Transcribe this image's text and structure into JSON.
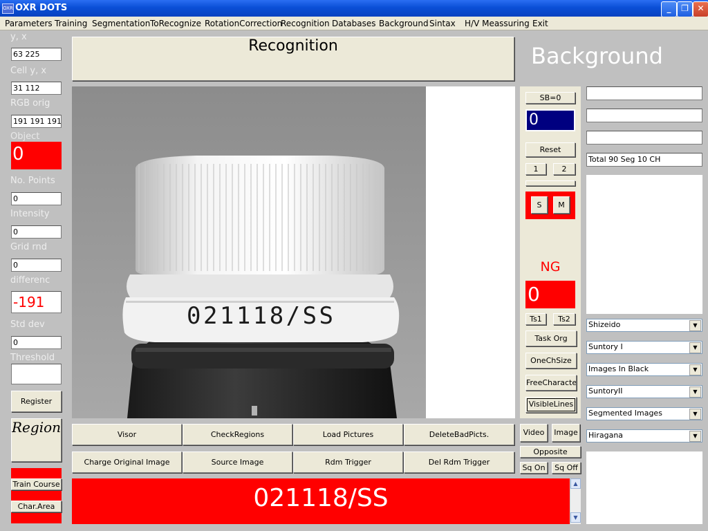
{
  "window": {
    "title": "OXR DOTS",
    "app_icon_text": "OXR",
    "min": "_",
    "restore": "❐",
    "close": "✕"
  },
  "menu": [
    "Parameters",
    "Training",
    "Segmentation",
    "ToRecognize",
    "RotationCorrection",
    "Recognition",
    "Databases",
    "Background",
    "Sintax",
    "H/V Meassuring",
    "Exit"
  ],
  "left": {
    "yx_label": "y, x",
    "yx_value": "63 225",
    "cell_label": "Cell y, x",
    "cell_value": "31 112",
    "rgb_label": "RGB orig",
    "rgb_value": "191 191 191",
    "object_label": "Object",
    "object_value": "0",
    "points_label": "No. Points",
    "points_value": "0",
    "intensity_label": "Intensity",
    "intensity_value": "0",
    "grid_label": "Grid rnd",
    "grid_value": "0",
    "diff_label": "differenc",
    "diff_value": "-191",
    "std_label": "Std dev",
    "std_value": "0",
    "threshold_label": "Threshold",
    "threshold_value": "",
    "register": "Register",
    "region_logo": "Region",
    "train_course": "Train Course",
    "char_area": "Char.Area"
  },
  "main": {
    "recognition_title": "Recognition",
    "background_title": "Background",
    "cap_print": "021118/SS",
    "buttons_row1": [
      "Visor",
      "CheckRegions",
      "Load Pictures",
      "DeleteBadPicts."
    ],
    "buttons_row2": [
      "Charge Original Image",
      "Source Image",
      "Rdm Trigger",
      "Del Rdm Trigger"
    ],
    "result_text": "021118/SS"
  },
  "controls": {
    "sb": "SB=0",
    "sb_value": "0",
    "reset": "Reset",
    "btn1": "1",
    "btn2": "2",
    "s": "S",
    "m": "M",
    "ng_label": "NG",
    "ng_value": "0",
    "ts1": "Ts1",
    "ts2": "Ts2",
    "task_org": "Task Org",
    "one_ch": "OneChSize",
    "free_char": "FreeCharacter",
    "visible_lines": "VisibleLines",
    "video": "Video",
    "image": "Image",
    "opposite": "Opposite",
    "sq_on": "Sq On",
    "sq_off": "Sq Off"
  },
  "right": {
    "field1": "",
    "field2": "",
    "field3": "",
    "total": "Total 90  Seg 10  CH",
    "combos": [
      "Shizeido",
      "Suntory I",
      "Images In Black",
      "SuntoryII",
      "Segmented Images",
      "Hiragana"
    ]
  },
  "colors": {
    "accent_red": "#ff0000",
    "sb_blue": "#000080",
    "panel_gray": "#c0c0c0"
  }
}
